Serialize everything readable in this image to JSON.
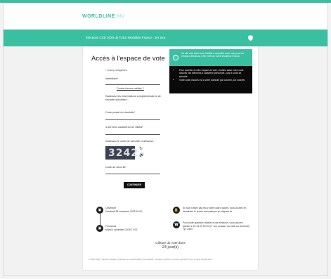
{
  "header": {
    "brand": "WORLDLINE",
    "brand_suffix": "MV",
    "banner_title": "Élections CSE 2025 de l'UES Worldline France - 1er tour"
  },
  "form": {
    "title": "Accès à l'espace de vote",
    "required_note": "* champ obligatoire",
    "username_label": "Identifiant*",
    "forgot_link": "Codes d'accès oubliés ?",
    "extra_info": "Saisissez les informations complémentaires de sécurité suivantes :",
    "postal_label": "Code postal du domicile*",
    "iban_label": "4 derniers caractères de l'IBAN*",
    "captcha_label": "Saisissez le code de sécurité ci-dessous :",
    "captcha_value": "3242",
    "captcha_refresh_icon": "refresh-icon",
    "captcha_audio_icon": "audio-icon",
    "security_label": "Code de sécurité*",
    "submit": "CONTINUER"
  },
  "schedule": {
    "opening_label": "Ouverture",
    "opening_date": "Vendredi 28 novembre 2025 10:00",
    "closing_label": "Fermeture",
    "closing_date": "Mardi 2 décembre 2025 17:00"
  },
  "help": {
    "lost_codes": "Si vous n'avez pas reçu votre code d'accès, vous pouvez en demander le renvoi automatique en cliquant ici",
    "contact": "Pour toute question relative à vos élections, vous pouvez joindre le 01 44 00 00 00 (n° non surtaxé, du lundi au vendredi) 7j/7 24h/7"
  },
  "countdown": {
    "line1": "Clôture du vote dans",
    "line2": "24 jour(s)"
  },
  "footer": "© 2025 WMV  |  Mentions légales  |  Politique de confidentialité  |  Accessibilité : partielle  |  Solution proposée par WMV® des Groupe WorldlineMV",
  "tooltip": {
    "heading": "Ce site web est le seul habilité à accueillir votre vote pour les élections Élections CSE 2025 de l'UES Worldline France.",
    "items": [
      "Pour accéder à votre espace de vote, veuillez saisir votre code d'accès, les éléments à caractère personnel, puis le code de sécurité",
      "Votre code d'accès est à votre domicile par courrier, par courrier."
    ]
  },
  "colors": {
    "accent": "#3bbfa3",
    "dark": "#0a0a0a"
  }
}
